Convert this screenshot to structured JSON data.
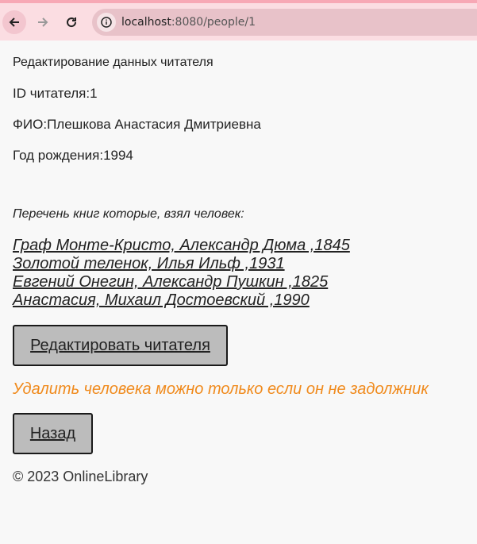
{
  "browser": {
    "url_host": "localhost",
    "url_path": ":8080/people/1"
  },
  "page": {
    "title": "Редактирование данных читателя",
    "id_line": "ID читателя:1",
    "fio_line": "ФИО:Плешкова Анастасия Дмитриевна",
    "year_line": "Год рождения:1994",
    "books_heading": "Перечень книг которые, взял человек:",
    "books": [
      {
        "label": "Граф Монте-Кристо, Александр Дюма ,1845"
      },
      {
        "label": "Золотой теленок, Илья Ильф ,1931"
      },
      {
        "label": "Евгений Онегин, Александр Пушкин ,1825"
      },
      {
        "label": "Анастасия, Михаил Достоевский ,1990"
      }
    ],
    "edit_button": "Редактировать читателя",
    "warning": "Удалить человека можно только если он не задолжник",
    "back_button": "Назад",
    "footer": "© 2023 OnlineLibrary"
  },
  "colors": {
    "toolbar": "#fbdde2",
    "warning": "#f08a1c",
    "button_bg": "#bcbcbc"
  }
}
